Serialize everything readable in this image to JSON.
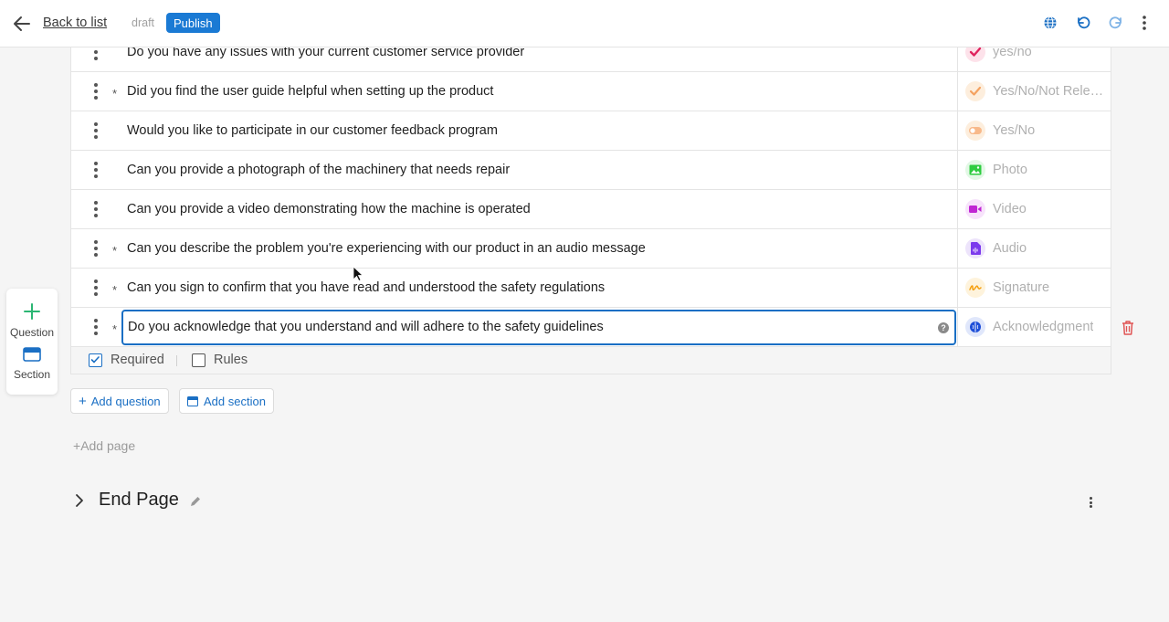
{
  "header": {
    "back_label": "Back to list",
    "status": "draft",
    "publish_label": "Publish"
  },
  "questions": [
    {
      "text": "Do you have any issues with your current customer service provider",
      "required": false,
      "type": "yes/no",
      "icon": "check-icon",
      "color": "#e0245e"
    },
    {
      "text": "Did you find the user guide helpful when setting up the product",
      "required": true,
      "type": "Yes/No/Not Relevant",
      "icon": "check-icon",
      "color": "#f4a261"
    },
    {
      "text": "Would you like to participate in our customer feedback program",
      "required": false,
      "type": "Yes/No",
      "icon": "toggle-icon",
      "color": "#f4a261"
    },
    {
      "text": "Can you provide a photograph of the machinery that needs repair",
      "required": false,
      "type": "Photo",
      "icon": "image-icon",
      "color": "#2ecc40"
    },
    {
      "text": "Can you provide a video demonstrating how the machine is operated",
      "required": false,
      "type": "Video",
      "icon": "video-icon",
      "color": "#c026d3"
    },
    {
      "text": "Can you describe the problem you're experiencing with our product in an audio message",
      "required": true,
      "type": "Audio",
      "icon": "audio-file-icon",
      "color": "#7c3aed"
    },
    {
      "text": "Can you sign to confirm that you have read and understood the safety regulations",
      "required": true,
      "type": "Signature",
      "icon": "signature-icon",
      "color": "#f59e0b"
    },
    {
      "text": "Do you acknowledge that you understand and will adhere to the safety guidelines",
      "required": true,
      "type": "Acknowledgment",
      "icon": "brain-icon",
      "color": "#1d4ed8"
    }
  ],
  "options": {
    "required_label": "Required",
    "rules_label": "Rules"
  },
  "actions": {
    "add_question": "Add question",
    "add_section": "Add section",
    "add_page": "Add page"
  },
  "end_page": {
    "title": "End Page"
  },
  "side_tools": {
    "question_label": "Question",
    "section_label": "Section"
  },
  "colors": {
    "accent": "#1a7ad4",
    "danger": "#e0245e",
    "tool_green": "#2bb673"
  }
}
